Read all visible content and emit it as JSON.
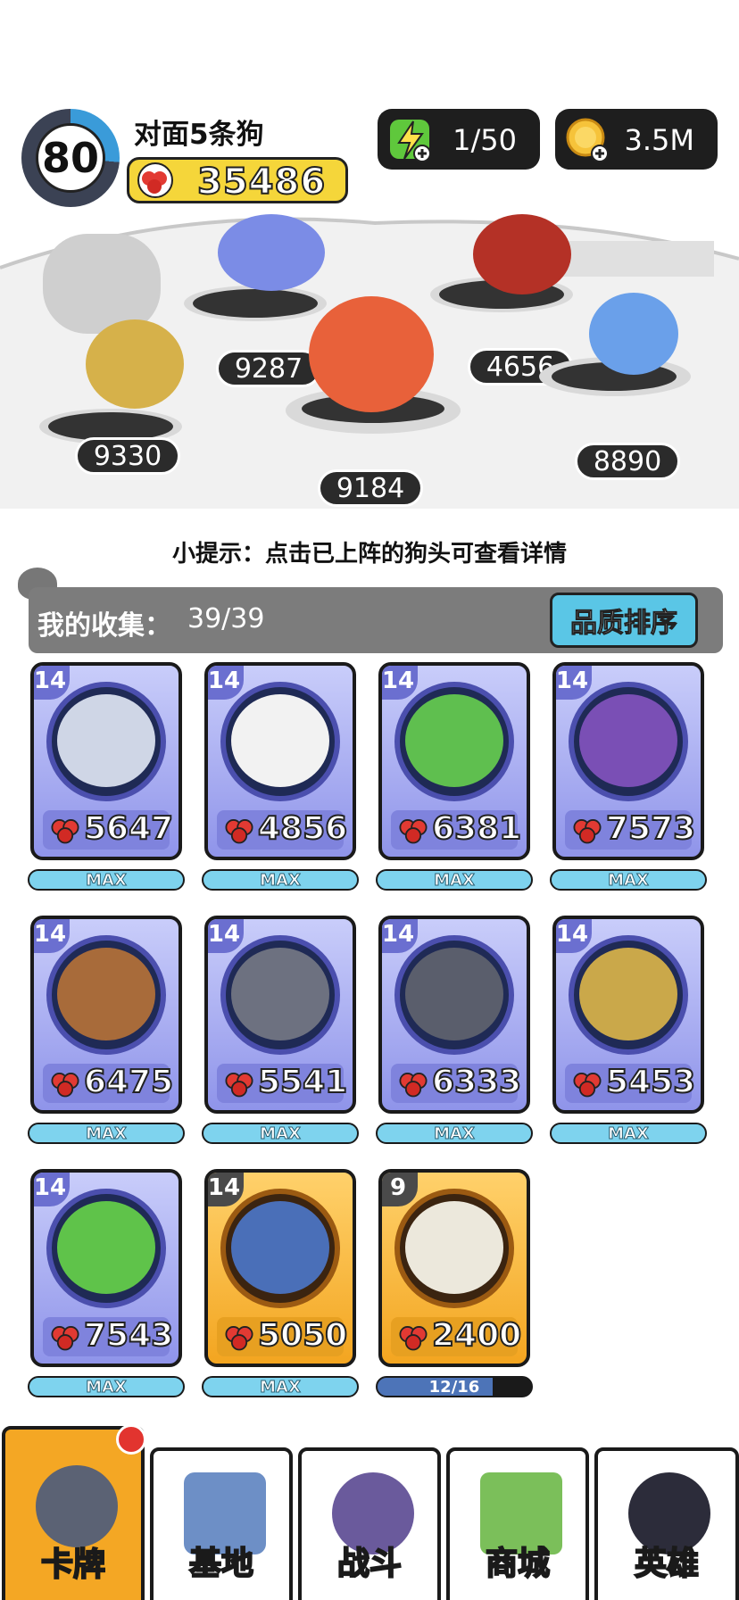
{
  "header": {
    "level": "80",
    "opponent_name": "对面5条狗",
    "power": "35486",
    "energy": "1/50",
    "coins": "3.5M"
  },
  "arena": {
    "slots": [
      {
        "hp": "9330",
        "color": "#d6b14a"
      },
      {
        "hp": "9287",
        "color": "#7b8ce6"
      },
      {
        "hp": "9184",
        "color": "#e8613a"
      },
      {
        "hp": "4656",
        "color": "#b43126"
      },
      {
        "hp": "8890",
        "color": "#6aa0ea"
      }
    ],
    "tip": "小提示：点击已上阵的狗头可查看详情"
  },
  "collection": {
    "label": "我的收集：",
    "count": "39/39",
    "sort_label": "品质排序",
    "cards": [
      {
        "level": "14",
        "power": "5647",
        "progress": "MAX",
        "rarity": "purple",
        "color": "#cfd6e6"
      },
      {
        "level": "14",
        "power": "4856",
        "progress": "MAX",
        "rarity": "purple",
        "color": "#f2f2f2"
      },
      {
        "level": "14",
        "power": "6381",
        "progress": "MAX",
        "rarity": "purple",
        "color": "#5fbf4f"
      },
      {
        "level": "14",
        "power": "7573",
        "progress": "MAX",
        "rarity": "purple",
        "color": "#7a4fb5"
      },
      {
        "level": "14",
        "power": "6475",
        "progress": "MAX",
        "rarity": "purple",
        "color": "#a86b3a"
      },
      {
        "level": "14",
        "power": "5541",
        "progress": "MAX",
        "rarity": "purple",
        "color": "#6d7180"
      },
      {
        "level": "14",
        "power": "6333",
        "progress": "MAX",
        "rarity": "purple",
        "color": "#5a5e6c"
      },
      {
        "level": "14",
        "power": "5453",
        "progress": "MAX",
        "rarity": "purple",
        "color": "#caa84a"
      },
      {
        "level": "14",
        "power": "7543",
        "progress": "MAX",
        "rarity": "purple",
        "color": "#5fc34a"
      },
      {
        "level": "14",
        "power": "5050",
        "progress": "MAX",
        "rarity": "gold",
        "color": "#4a6fb8"
      },
      {
        "level": "9",
        "power": "2400",
        "progress": "12/16",
        "rarity": "gold",
        "color": "#ece8dc"
      }
    ]
  },
  "nav": {
    "tabs": [
      {
        "label": "卡牌",
        "color": "#5b6274"
      },
      {
        "label": "基地",
        "color": "#6d8fc6"
      },
      {
        "label": "战斗",
        "color": "#6a5a9c"
      },
      {
        "label": "商城",
        "color": "#7bbf5a"
      },
      {
        "label": "英雄",
        "color": "#2c2c3a"
      }
    ]
  }
}
